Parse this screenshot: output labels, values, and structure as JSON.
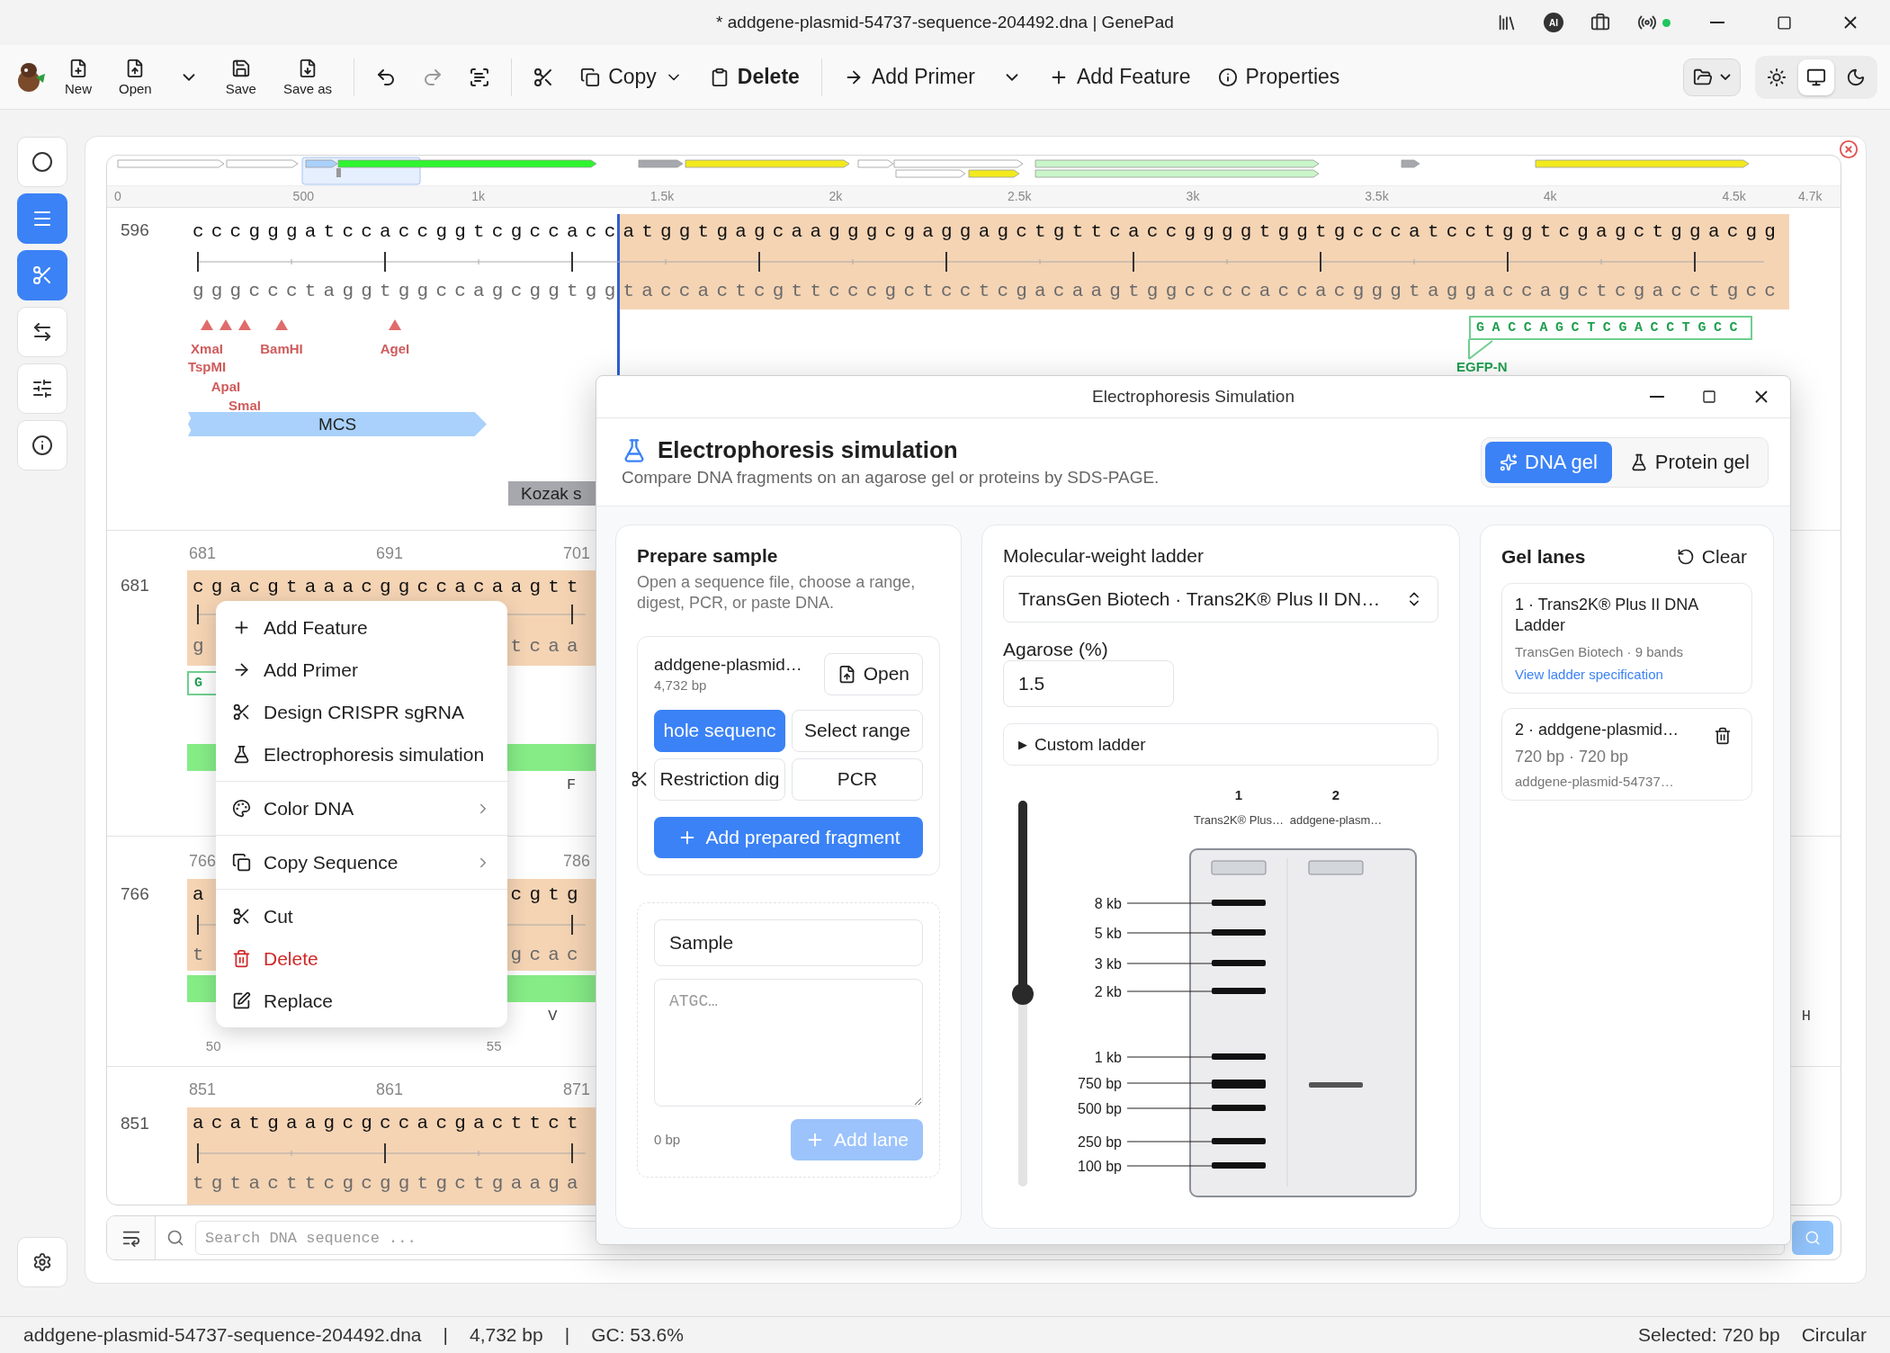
{
  "window": {
    "title": "* addgene-plasmid-54737-sequence-204492.dna | GenePad",
    "ai_badge": "AI",
    "status_online": true
  },
  "toolbar": {
    "new": "New",
    "open": "Open",
    "save": "Save",
    "save_as": "Save as",
    "copy": "Copy",
    "delete": "Delete",
    "add_primer": "Add Primer",
    "add_feature": "Add Feature",
    "properties": "Properties",
    "theme_options": [
      {
        "selected": false
      },
      {
        "selected": true
      },
      {
        "selected": false
      }
    ]
  },
  "sidebar": {
    "tools": [
      {
        "on": false
      },
      {
        "on": true
      },
      {
        "on": true
      },
      {
        "on": false
      },
      {
        "on": false
      },
      {
        "on": false
      }
    ]
  },
  "sequence_map": {
    "ticks": [
      "0",
      "500",
      "1k",
      "1.5k",
      "2k",
      "2.5k",
      "3k",
      "3.5k",
      "4k",
      "4.5k",
      "4.7k"
    ]
  },
  "first_row": {
    "number": "596",
    "top_plain": "cccgggatccaccggtcgccacc",
    "top_selected": "atggtgagcaagggcgaggagctgttcaccggggtggtgcccatcctggtcgagctggacgg",
    "bottom_plain": "gggccctaggtggccagcggtgg",
    "bottom_selected": "taccactcgttcccgctcctcgacaagtggccccaccacgggtaggaccagctcgacctgcc",
    "enzymes": [
      {
        "name": "XmaI"
      },
      {
        "name": "TspMI"
      },
      {
        "name": "ApaI"
      },
      {
        "name": "SmaI"
      },
      {
        "name": "BamHI"
      },
      {
        "name": "AgeI"
      }
    ],
    "features": [
      {
        "label": "MCS",
        "kind": "misc"
      },
      {
        "label": "Kozak s",
        "kind": "regulatory"
      }
    ],
    "primer": {
      "sequence": "GACCAGCTCGACCTGCC",
      "name": "EGFP-N"
    }
  },
  "rows": [
    {
      "number": "681",
      "ruler": [
        "681",
        "691",
        "701"
      ],
      "top_left": "cgacgtaaacggccacaagtt",
      "bottom_left": "g",
      "bottom_right": "tcaa",
      "primer": "G",
      "feature_bar": true,
      "amino_acids": [
        "F"
      ]
    },
    {
      "number": "766",
      "ruler": [
        "766",
        "786"
      ],
      "top_left": "a",
      "top_right": "cgtg",
      "bottom_left": "t",
      "bottom_right": "gcac",
      "feature_bar": true,
      "amino_acids": [
        "V",
        "H"
      ],
      "aa_ruler": [
        "50",
        "55"
      ]
    },
    {
      "number": "851",
      "ruler": [
        "851",
        "861",
        "871"
      ],
      "top_left": "acatgaagcgccacgacttct",
      "bottom_left": "tgtacttcgcggtgctgaaga",
      "feature_bar": false
    }
  ],
  "search": {
    "placeholder": "Search DNA sequence ..."
  },
  "context_menu": {
    "groups": [
      [
        {
          "label": "Add Feature",
          "kind": "action"
        },
        {
          "label": "Add Primer",
          "kind": "action"
        },
        {
          "label": "Design CRISPR sgRNA",
          "kind": "action"
        },
        {
          "label": "Electrophoresis simulation",
          "kind": "action"
        }
      ],
      [
        {
          "label": "Color DNA",
          "kind": "submenu"
        }
      ],
      [
        {
          "label": "Copy Sequence",
          "kind": "submenu"
        }
      ],
      [
        {
          "label": "Cut",
          "kind": "action"
        },
        {
          "label": "Delete",
          "kind": "danger"
        },
        {
          "label": "Replace",
          "kind": "action"
        }
      ]
    ]
  },
  "dialog": {
    "title": "Electrophoresis Simulation",
    "heading": "Electrophoresis simulation",
    "subtitle": "Compare DNA fragments on an agarose gel or proteins by SDS-PAGE.",
    "gel_types": [
      {
        "label": "DNA gel",
        "selected": true
      },
      {
        "label": "Protein gel",
        "selected": false
      }
    ],
    "prepare": {
      "title": "Prepare sample",
      "description": "Open a sequence file, choose a range, digest, PCR, or paste DNA.",
      "file_name": "addgene-plasmid…",
      "file_size": "4,732 bp",
      "open_button": "Open",
      "modes": [
        {
          "label": "hole sequenc",
          "selected": true
        },
        {
          "label": "Select range",
          "selected": false
        },
        {
          "label": "Restriction dig",
          "selected": false
        },
        {
          "label": "PCR",
          "selected": false
        }
      ],
      "add_fragment": "Add prepared fragment",
      "sample_name": "Sample",
      "sequence_placeholder": "ATGC…",
      "length": "0 bp",
      "add_lane": {
        "label": "Add lane",
        "disabled": true
      }
    },
    "ladder": {
      "title": "Molecular-weight ladder",
      "selected": "TransGen Biotech · Trans2K® Plus II DN…",
      "agarose_label": "Agarose (%)",
      "agarose": "1.5",
      "custom": {
        "toggle": "▶",
        "label": "Custom ladder",
        "expanded": false
      },
      "zoom": {
        "level": 0.5
      },
      "lanes": [
        {
          "number": "1",
          "name": "Trans2K® Plus…",
          "kind": "ladder"
        },
        {
          "number": "2",
          "name": "addgene-plasm…",
          "kind": "sample"
        }
      ],
      "bands": [
        "8 kb",
        "5 kb",
        "3 kb",
        "2 kb",
        "1 kb",
        "750 bp",
        "500 bp",
        "250 bp",
        "100 bp"
      ]
    },
    "lanes_panel": {
      "title": "Gel lanes",
      "clear": "Clear",
      "lanes": [
        {
          "title": "1 · Trans2K® Plus II DNA Ladder",
          "detail": "TransGen Biotech · 9 bands",
          "link": "View ladder specification",
          "removable": false
        },
        {
          "title": "2 · addgene-plasmid…",
          "detail": "720 bp · 720 bp",
          "source": "addgene-plasmid-54737…",
          "removable": true
        }
      ]
    }
  },
  "status_bar": {
    "left": [
      "addgene-plasmid-54737-sequence-204492.dna",
      "|",
      "4,732 bp",
      "|",
      "GC: 53.6%"
    ],
    "right": [
      "Selected: 720 bp",
      "Circular"
    ]
  }
}
